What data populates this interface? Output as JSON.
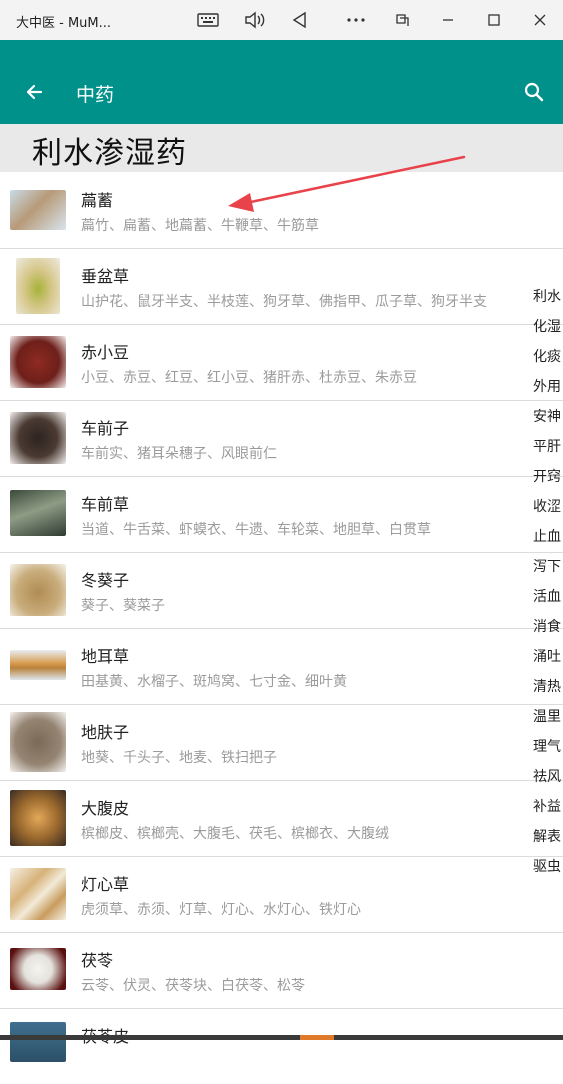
{
  "window": {
    "title": "大中医 - MuM...",
    "buttons": [
      "keyboard-icon",
      "volume-icon",
      "back-triangle-icon",
      "more-icon",
      "resize-icon",
      "minimize-icon",
      "maximize-icon",
      "close-icon"
    ]
  },
  "header": {
    "title": "中药",
    "back_icon": "arrow-left-icon",
    "search_icon": "search-icon",
    "background": "#00918a"
  },
  "section": {
    "heading": "利水渗湿药"
  },
  "items": [
    {
      "name": "萹蓄",
      "aliases": "萹竹、扁蓄、地萹蓄、牛鞭草、牛筋草"
    },
    {
      "name": "垂盆草",
      "aliases": "山护花、鼠牙半支、半枝莲、狗牙草、佛指甲、瓜子草、狗牙半支"
    },
    {
      "name": "赤小豆",
      "aliases": "小豆、赤豆、红豆、红小豆、猪肝赤、杜赤豆、朱赤豆"
    },
    {
      "name": "车前子",
      "aliases": "车前实、猪耳朵穗子、风眼前仁"
    },
    {
      "name": "车前草",
      "aliases": "当道、牛舌菜、虾蟆衣、牛遗、车轮菜、地胆草、白贯草"
    },
    {
      "name": "冬葵子",
      "aliases": "葵子、葵菜子"
    },
    {
      "name": "地耳草",
      "aliases": "田基黄、水榴子、斑鸠窝、七寸金、细叶黄"
    },
    {
      "name": "地肤子",
      "aliases": "地葵、千头子、地麦、铁扫把子"
    },
    {
      "name": "大腹皮",
      "aliases": "槟榔皮、槟榔壳、大腹毛、茯毛、槟榔衣、大腹绒"
    },
    {
      "name": "灯心草",
      "aliases": "虎须草、赤须、灯草、灯心、水灯心、铁灯心"
    },
    {
      "name": "茯苓",
      "aliases": "云苓、伏灵、茯苓块、白茯苓、松苓"
    },
    {
      "name": "茯苓皮",
      "aliases": ""
    }
  ],
  "side_index": [
    "利水",
    "化湿",
    "化痰",
    "外用",
    "安神",
    "平肝",
    "开窍",
    "收涩",
    "止血",
    "泻下",
    "活血",
    "消食",
    "涌吐",
    "清热",
    "温里",
    "理气",
    "祛风",
    "补益",
    "解表",
    "驱虫"
  ],
  "annotation": {
    "arrow_color": "#e8424a"
  }
}
